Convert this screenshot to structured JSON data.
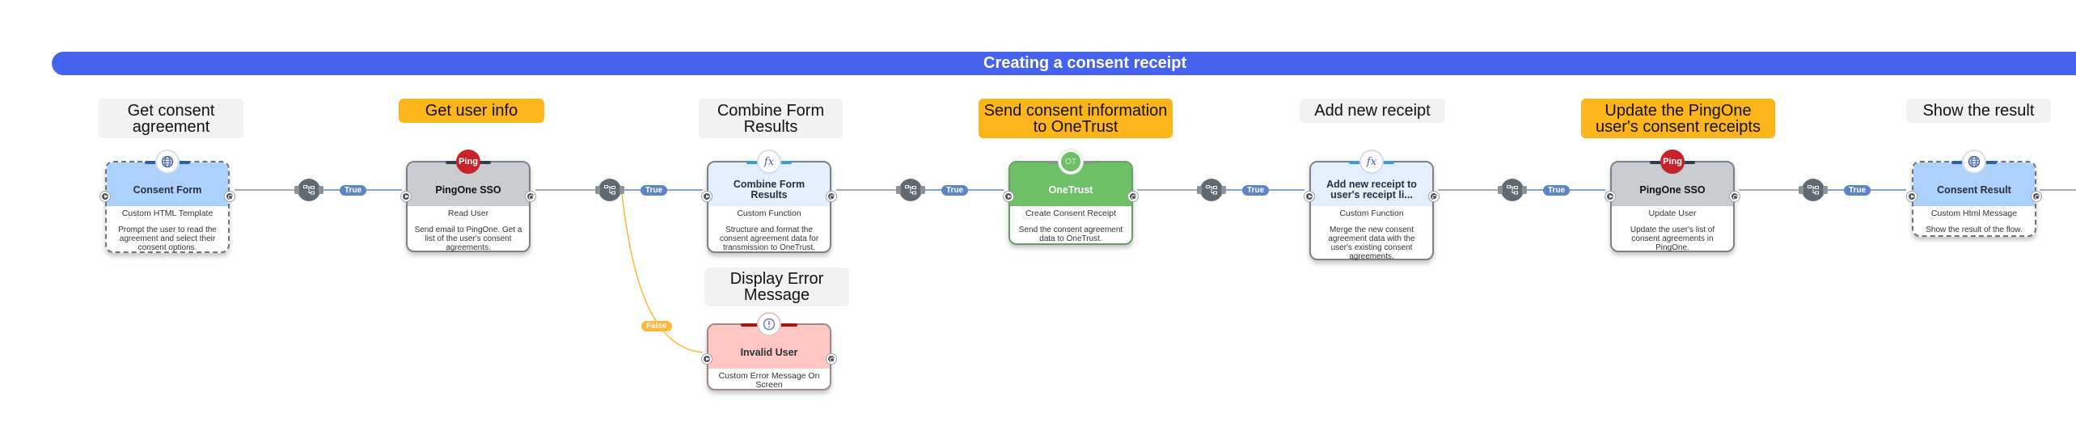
{
  "banner": {
    "title": "Creating a consent receipt",
    "color": "#4563EC"
  },
  "colors": {
    "label_grey": "#F1F2F4",
    "label_amber": "#FDB51C",
    "html_header": "#ACD2FC",
    "function_header": "#E3EFFD",
    "pingone_header": "#C9CCD1",
    "onetrust_header": "#6CC065",
    "error_header": "#FFC7C3",
    "edge_true": "#5E84C4",
    "edge_false": "#FDB83A",
    "edge_default": "#8a8f94"
  },
  "steps": [
    {
      "label": "Get consent agreement",
      "label_style": "grey",
      "node": {
        "title": "Consent Form",
        "type": "Custom HTML Template",
        "description": "Prompt the user to read the agreement and select their consent options.",
        "icon": "globe-icon",
        "kind": "html"
      }
    },
    {
      "label": "Get user info",
      "label_style": "amber",
      "node": {
        "title": "PingOne SSO",
        "type": "Read User",
        "description": "Send email to PingOne. Get a list of the user's consent agreements.",
        "icon": "ping-logo-icon",
        "icon_text": "Ping",
        "kind": "pingone"
      }
    },
    {
      "label": "Combine Form Results",
      "label_style": "grey",
      "node": {
        "title": "Combine Form Results",
        "type": "Custom Function",
        "description": "Structure and format the consent agreement data for transmission to OneTrust.",
        "icon": "function-icon",
        "icon_text": "fx",
        "kind": "function"
      }
    },
    {
      "label": "Send consent information to OneTrust",
      "label_style": "amber",
      "node": {
        "title": "OneTrust",
        "type": "Create Consent Receipt",
        "description": "Send the consent agreement data to OneTrust.",
        "icon": "onetrust-logo-icon",
        "icon_text": "OT",
        "kind": "onetrust"
      }
    },
    {
      "label": "Add new receipt",
      "label_style": "grey",
      "node": {
        "title": "Add new receipt to user's receipt li...",
        "type": "Custom Function",
        "description": "Merge the new consent agreement data with the user's existing consent agreements.",
        "icon": "function-icon",
        "icon_text": "fx",
        "kind": "function"
      }
    },
    {
      "label": "Update the PingOne user's consent receipts",
      "label_style": "amber",
      "node": {
        "title": "PingOne SSO",
        "type": "Update User",
        "description": "Update the user's list of consent agreements in PingOne.",
        "icon": "ping-logo-icon",
        "icon_text": "Ping",
        "kind": "pingone"
      }
    },
    {
      "label": "Show the result",
      "label_style": "grey",
      "node": {
        "title": "Consent Result",
        "type": "Custom Html Message",
        "description": "Show the result of the flow.",
        "icon": "globe-icon",
        "kind": "html"
      }
    }
  ],
  "error_branch": {
    "label": "Display Error Message",
    "label_style": "grey",
    "node": {
      "title": "Invalid User",
      "type": "Custom Error Message On Screen",
      "description": "",
      "icon": "alert-icon",
      "icon_text": "!",
      "kind": "error"
    }
  },
  "edges": {
    "true_label": "True",
    "false_label": "False"
  }
}
